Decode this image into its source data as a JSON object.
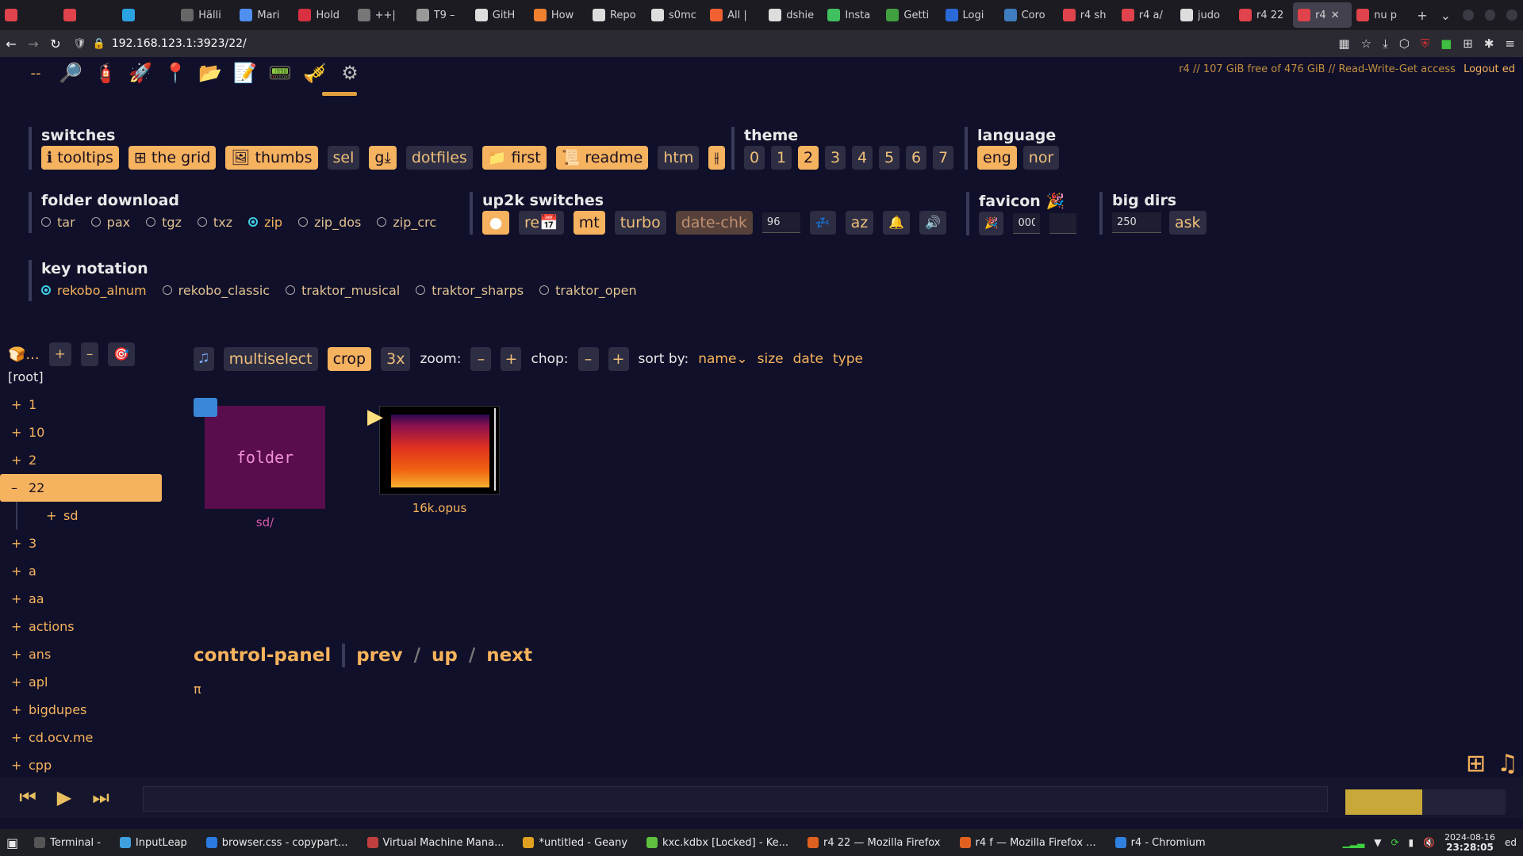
{
  "browser": {
    "tabs": [
      {
        "title": "",
        "color": "#e0434b"
      },
      {
        "title": "",
        "color": "#e0434b"
      },
      {
        "title": "",
        "color": "#2aa3e0"
      },
      {
        "title": "Hälli",
        "color": "#666666"
      },
      {
        "title": "Mari",
        "color": "#4f8ff0"
      },
      {
        "title": "Hold",
        "color": "#d83040"
      },
      {
        "title": "++|",
        "color": "#777777"
      },
      {
        "title": "T9 –",
        "color": "#999999"
      },
      {
        "title": "GitH",
        "color": "#dddddd"
      },
      {
        "title": "How",
        "color": "#f08030"
      },
      {
        "title": "Repo",
        "color": "#dddddd"
      },
      {
        "title": "s0mc",
        "color": "#dddddd"
      },
      {
        "title": "All |",
        "color": "#f06030"
      },
      {
        "title": "dshie",
        "color": "#dddddd"
      },
      {
        "title": "Insta",
        "color": "#40c060"
      },
      {
        "title": "Getti",
        "color": "#40a040"
      },
      {
        "title": "Logi",
        "color": "#2a6ad8"
      },
      {
        "title": "Coro",
        "color": "#3f7cc0"
      },
      {
        "title": "r4 sh",
        "color": "#e0434b"
      },
      {
        "title": "r4 a/",
        "color": "#e0434b"
      },
      {
        "title": "judo",
        "color": "#dddddd"
      },
      {
        "title": "r4 22",
        "color": "#e0434b"
      },
      {
        "title": "r4",
        "color": "#e0434b",
        "active": true
      },
      {
        "title": "nu p",
        "color": "#e0434b"
      }
    ],
    "url": "192.168.123.1:3923/22/"
  },
  "topbar": {
    "dash": "--",
    "status": "r4 // 107 GiB free of 476 GiB // Read-Write-Get access",
    "logout": "Logout ed"
  },
  "switches": {
    "title": "switches",
    "items": [
      {
        "label": "ℹ tooltips",
        "on": true
      },
      {
        "label": "⊞ the grid",
        "on": true
      },
      {
        "label": "🖼 thumbs",
        "on": true
      },
      {
        "label": "sel",
        "on": false
      },
      {
        "label": "g⤓",
        "on": true
      },
      {
        "label": "dotfiles",
        "on": false
      },
      {
        "label": "📁 first",
        "on": true
      },
      {
        "label": "📜 readme",
        "on": true
      },
      {
        "label": "htm",
        "on": false
      },
      {
        "label": "⫲",
        "on": true
      }
    ]
  },
  "theme": {
    "title": "theme",
    "items": [
      "0",
      "1",
      "2",
      "3",
      "4",
      "5",
      "6",
      "7"
    ],
    "selected": "2"
  },
  "language": {
    "title": "language",
    "items": [
      "eng",
      "nor"
    ],
    "selected": "eng"
  },
  "folder_download": {
    "title": "folder download",
    "options": [
      "tar",
      "pax",
      "tgz",
      "txz",
      "zip",
      "zip_dos",
      "zip_crc"
    ],
    "selected": "zip"
  },
  "up2k": {
    "title": "up2k switches",
    "re": "re📅",
    "mt": "mt",
    "turbo": "turbo",
    "datechk": "date-chk",
    "threads": "96",
    "sleep": "💤",
    "az": "az",
    "bell": "🔔",
    "sound": "🔊"
  },
  "favicon": {
    "title": "favicon 🎉",
    "emoji": "🎉",
    "value": "000",
    "value2": ""
  },
  "bigdirs": {
    "title": "big dirs",
    "value": "250",
    "ask": "ask"
  },
  "key_notation": {
    "title": "key notation",
    "options": [
      "rekobo_alnum",
      "rekobo_classic",
      "traktor_musical",
      "traktor_sharps",
      "traktor_open"
    ],
    "selected": "rekobo_alnum"
  },
  "tree": {
    "head_label": "🍞...",
    "plus": "+",
    "minus": "–",
    "target": "🎯",
    "root": "[root]",
    "nodes": [
      {
        "pm": "+",
        "name": "1"
      },
      {
        "pm": "+",
        "name": "10"
      },
      {
        "pm": "+",
        "name": "2"
      },
      {
        "pm": "–",
        "name": "22",
        "current": true
      },
      {
        "pm": "+",
        "name": "sd",
        "child": true
      },
      {
        "pm": "+",
        "name": "3"
      },
      {
        "pm": "+",
        "name": "a"
      },
      {
        "pm": "+",
        "name": "aa"
      },
      {
        "pm": "+",
        "name": "actions"
      },
      {
        "pm": "+",
        "name": "ans"
      },
      {
        "pm": "+",
        "name": "apl"
      },
      {
        "pm": "+",
        "name": "bigdupes"
      },
      {
        "pm": "+",
        "name": "cd.ocv.me"
      },
      {
        "pm": "+",
        "name": "cpp"
      }
    ]
  },
  "filetoolbar": {
    "music": "🎜",
    "multiselect": "multiselect",
    "crop": "crop",
    "x3": "3x",
    "zoom_label": "zoom:",
    "minus": "–",
    "plus": "+",
    "chop_label": "chop:",
    "sort_label": "sort by:",
    "sort_items": [
      "name⌄",
      "size",
      "date",
      "type"
    ]
  },
  "files": [
    {
      "kind": "folder",
      "label": "folder",
      "name": "sd/"
    },
    {
      "kind": "audio",
      "name": "16k.opus"
    }
  ],
  "control": {
    "title": "control-panel",
    "prev": "prev",
    "up": "up",
    "next": "next",
    "slash": "/",
    "pi": "π"
  },
  "player": {
    "prev": "⏮",
    "play": "▶",
    "next": "⏭",
    "volume": 0.48
  },
  "taskbar": {
    "items": [
      {
        "label": "Terminal -",
        "color": "#555555"
      },
      {
        "label": "InputLeap",
        "color": "#3fa0e0"
      },
      {
        "label": "browser.css - copypart...",
        "color": "#2a7ae0"
      },
      {
        "label": "Virtual Machine Mana...",
        "color": "#c04040"
      },
      {
        "label": "*untitled - Geany",
        "color": "#e0a020"
      },
      {
        "label": "kxc.kdbx [Locked] - Ke...",
        "color": "#60c040"
      },
      {
        "label": "r4 22 — Mozilla Firefox",
        "color": "#e06020"
      },
      {
        "label": "r4 f — Mozilla Firefox ...",
        "color": "#e06020"
      },
      {
        "label": "r4 - Chromium",
        "color": "#3080e0"
      }
    ],
    "date": "2024-08-16",
    "time": "23:28:05",
    "user": "ed"
  }
}
